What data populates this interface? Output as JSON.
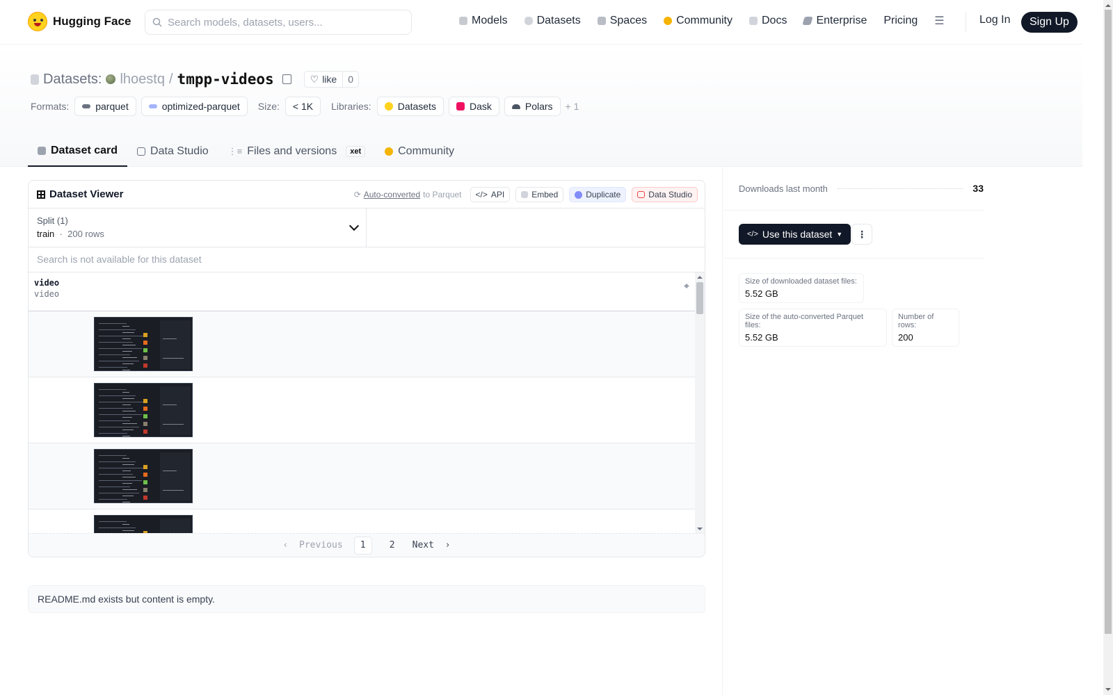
{
  "brand": {
    "name": "Hugging Face"
  },
  "search": {
    "placeholder": "Search models, datasets, users..."
  },
  "nav": {
    "links": [
      {
        "label": "Models",
        "icon": "models-icon"
      },
      {
        "label": "Datasets",
        "icon": "datasets-icon"
      },
      {
        "label": "Spaces",
        "icon": "spaces-icon"
      },
      {
        "label": "Community",
        "icon": "community-icon"
      },
      {
        "label": "Docs",
        "icon": "docs-icon"
      },
      {
        "label": "Enterprise",
        "icon": "enterprise-icon"
      },
      {
        "label": "Pricing",
        "icon": ""
      }
    ],
    "login": "Log In",
    "signup": "Sign Up"
  },
  "header": {
    "prefix": "Datasets:",
    "owner": "lhoestq",
    "slash": "/",
    "name": "tmpp-videos",
    "like_label": "like",
    "like_count": "0",
    "formats_label": "Formats:",
    "formats": [
      "parquet",
      "optimized-parquet"
    ],
    "size_label": "Size:",
    "size": "< 1K",
    "libraries_label": "Libraries:",
    "libraries": [
      "Datasets",
      "Dask",
      "Polars"
    ],
    "more": "+ 1"
  },
  "tabs": [
    {
      "label": "Dataset card",
      "active": true
    },
    {
      "label": "Data Studio",
      "active": false
    },
    {
      "label": "Files and versions",
      "active": false,
      "badge": "xet"
    },
    {
      "label": "Community",
      "active": false
    }
  ],
  "viewer": {
    "title": "Dataset Viewer",
    "auto_converted": "Auto-converted",
    "to_parquet": "to Parquet",
    "api": "API",
    "embed": "Embed",
    "duplicate": "Duplicate",
    "data_studio": "Data Studio",
    "split_label": "Split (1)",
    "split_name": "train",
    "split_dot": "·",
    "split_rows": "200 rows",
    "search_na": "Search is not available for this dataset",
    "column": {
      "name": "video",
      "type": "video"
    },
    "rows_count": 4,
    "pager": {
      "prev": "Previous",
      "pages": [
        "1",
        "2"
      ],
      "next": "Next",
      "current": "1"
    }
  },
  "readme": {
    "text": "README.md exists but content is empty."
  },
  "sidebar": {
    "downloads_label": "Downloads last month",
    "downloads_value": "33",
    "use_button": "Use this dataset",
    "stats": [
      {
        "label": "Size of downloaded dataset files:",
        "value": "5.52 GB"
      },
      {
        "label": "Size of the auto-converted Parquet files:",
        "value": "5.52 GB"
      },
      {
        "label": "Number of rows:",
        "value": "200"
      }
    ]
  },
  "colors": {
    "primary_dark": "#111827",
    "brand_yellow": "#FFD21E",
    "border": "#e5e7eb"
  }
}
